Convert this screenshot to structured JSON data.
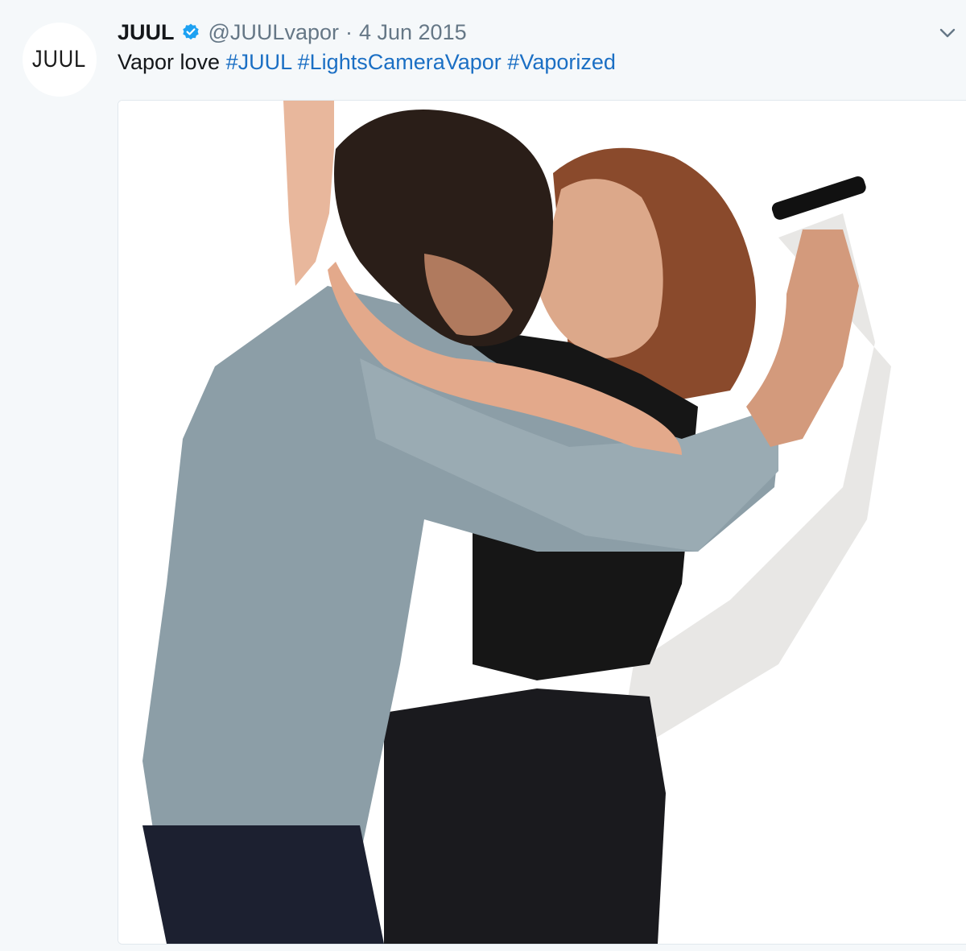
{
  "tweet": {
    "avatar_text": "JUUL",
    "display_name": "JUUL",
    "verified_icon": "verified-badge-icon",
    "handle": "@JUULvapor",
    "separator": "·",
    "date": "4 Jun 2015",
    "menu_icon": "chevron-down-icon",
    "text_prefix": "Vapor love",
    "hashtags": [
      "#JUUL",
      "#LightsCameraVapor",
      "#Vaporized"
    ],
    "media_icon": "photo-couple-kissing-image"
  },
  "colors": {
    "background": "#f5f8fa",
    "text": "#14171a",
    "muted": "#657786",
    "hashtag": "#1b6fc4",
    "verified": "#1da1f2"
  }
}
